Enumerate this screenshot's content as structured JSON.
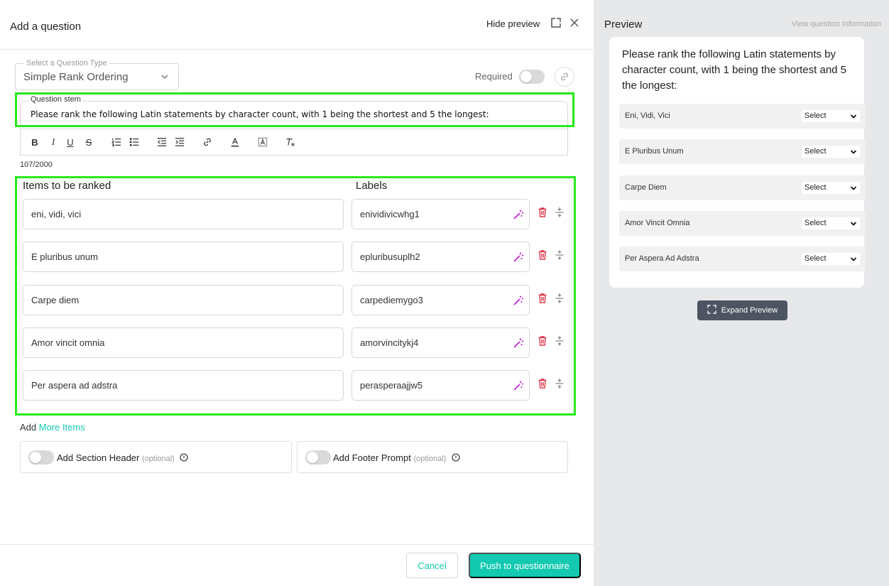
{
  "header": {
    "title": "Add a question",
    "hide_preview": "Hide preview",
    "popout_icon": "popout-icon",
    "close_icon": "close-icon"
  },
  "question_type": {
    "label": "Select a Question Type",
    "value": "Simple Rank Ordering"
  },
  "required": {
    "label": "Required",
    "enabled": false
  },
  "stem": {
    "label": "Question stem",
    "text": "Please rank the following Latin statements by character count, with 1 being the shortest and 5 the longest:",
    "char_count": "107/2000"
  },
  "toolbar": [
    "bold",
    "italic",
    "underline",
    "strikethrough",
    "ordered-list",
    "bullet-list",
    "outdent",
    "indent",
    "link",
    "text-color",
    "background-color",
    "clear-format"
  ],
  "items": {
    "items_header": "Items to be ranked",
    "labels_header": "Labels",
    "rows": [
      {
        "item": "eni, vidi, vici",
        "label": "enividivicwhg1"
      },
      {
        "item": "E pluribus unum",
        "label": "epluribusuplh2"
      },
      {
        "item": "Carpe diem",
        "label": "carpediemygo3"
      },
      {
        "item": "Amor vincit omnia",
        "label": "amorvincitykj4"
      },
      {
        "item": "Per aspera ad adstra",
        "label": "perasperaajjw5"
      }
    ]
  },
  "add_more": {
    "prefix": "Add ",
    "link": "More Items"
  },
  "options": {
    "section_header": "Add Section Header",
    "footer_prompt": "Add Footer Prompt",
    "optional": "(optional)"
  },
  "footer": {
    "cancel": "Cancel",
    "push": "Push to questionnaire"
  },
  "preview": {
    "title": "Preview",
    "info_link": "View question Information",
    "question": "Please rank the following Latin statements by character count, with 1 being the shortest and 5 the longest:",
    "rows": [
      {
        "label": "Eni, Vidi, Vici",
        "select": "Select"
      },
      {
        "label": "E Pluribus Unum",
        "select": "Select"
      },
      {
        "label": "Carpe Diem",
        "select": "Select"
      },
      {
        "label": "Amor Vincit Omnia",
        "select": "Select"
      },
      {
        "label": "Per Aspera Ad Adstra",
        "select": "Select"
      }
    ],
    "expand": "Expand Preview"
  },
  "colors": {
    "accent": "#13c9b0",
    "highlight": "#29e81d",
    "danger": "#e0354a",
    "wand": "#c21bd6"
  }
}
